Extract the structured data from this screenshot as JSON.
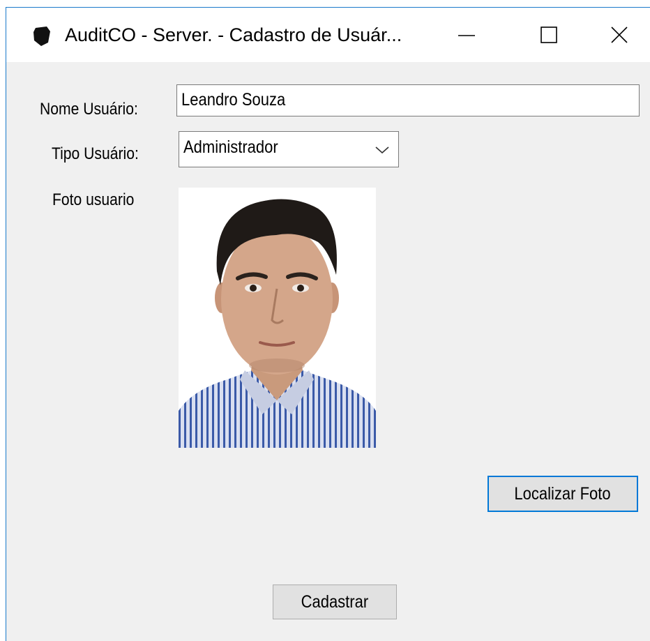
{
  "window": {
    "title": "AuditCO - Server. - Cadastro de Usuár...",
    "icon": "shield-icon",
    "controls": [
      "minimize-icon",
      "maximize-icon",
      "close-icon"
    ],
    "accent_color": "#0078d7"
  },
  "form": {
    "nome_label": "Nome Usuário:",
    "nome_value": "Leandro Souza",
    "tipo_label": "Tipo Usuário:",
    "tipo_value": "Administrador",
    "foto_label": "Foto usuario"
  },
  "buttons": {
    "localizar_foto": "Localizar Foto",
    "cadastrar": "Cadastrar"
  }
}
